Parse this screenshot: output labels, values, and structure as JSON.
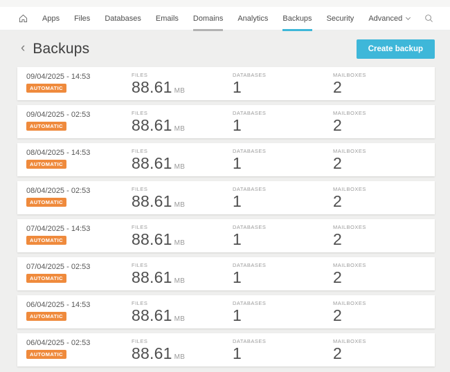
{
  "nav": {
    "items": [
      {
        "label": "Apps",
        "state": "",
        "chevron": false
      },
      {
        "label": "Files",
        "state": "",
        "chevron": false
      },
      {
        "label": "Databases",
        "state": "",
        "chevron": false
      },
      {
        "label": "Emails",
        "state": "",
        "chevron": false
      },
      {
        "label": "Domains",
        "state": "section",
        "chevron": false
      },
      {
        "label": "Analytics",
        "state": "",
        "chevron": false
      },
      {
        "label": "Backups",
        "state": "active",
        "chevron": false
      },
      {
        "label": "Security",
        "state": "",
        "chevron": false
      },
      {
        "label": "Advanced",
        "state": "",
        "chevron": true
      }
    ]
  },
  "header": {
    "back_icon": "‹",
    "title": "Backups",
    "create_button_label": "Create backup"
  },
  "columns": {
    "files": "FILES",
    "databases": "DATABASES",
    "mailboxes": "MAILBOXES"
  },
  "rows": [
    {
      "datetime": "09/04/2025 - 14:53",
      "badge": "AUTOMATIC",
      "files_value": "88.61",
      "files_unit": "MB",
      "databases": "1",
      "mailboxes": "2"
    },
    {
      "datetime": "09/04/2025 - 02:53",
      "badge": "AUTOMATIC",
      "files_value": "88.61",
      "files_unit": "MB",
      "databases": "1",
      "mailboxes": "2"
    },
    {
      "datetime": "08/04/2025 - 14:53",
      "badge": "AUTOMATIC",
      "files_value": "88.61",
      "files_unit": "MB",
      "databases": "1",
      "mailboxes": "2"
    },
    {
      "datetime": "08/04/2025 - 02:53",
      "badge": "AUTOMATIC",
      "files_value": "88.61",
      "files_unit": "MB",
      "databases": "1",
      "mailboxes": "2"
    },
    {
      "datetime": "07/04/2025 - 14:53",
      "badge": "AUTOMATIC",
      "files_value": "88.61",
      "files_unit": "MB",
      "databases": "1",
      "mailboxes": "2"
    },
    {
      "datetime": "07/04/2025 - 02:53",
      "badge": "AUTOMATIC",
      "files_value": "88.61",
      "files_unit": "MB",
      "databases": "1",
      "mailboxes": "2"
    },
    {
      "datetime": "06/04/2025 - 14:53",
      "badge": "AUTOMATIC",
      "files_value": "88.61",
      "files_unit": "MB",
      "databases": "1",
      "mailboxes": "2"
    },
    {
      "datetime": "06/04/2025 - 02:53",
      "badge": "AUTOMATIC",
      "files_value": "88.61",
      "files_unit": "MB",
      "databases": "1",
      "mailboxes": "2"
    }
  ],
  "colors": {
    "accent": "#3eb7d9",
    "badge": "#ef8a3c",
    "section_underline": "#b3b3b3"
  }
}
